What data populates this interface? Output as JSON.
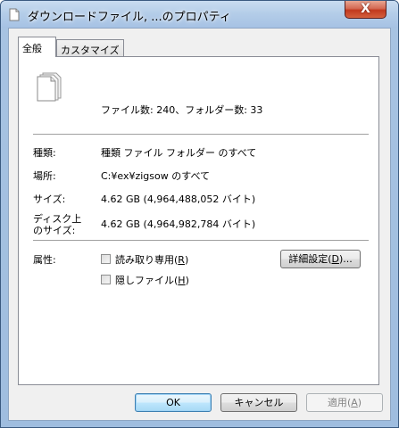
{
  "window": {
    "title": "ダウンロードファイル, ...のプロパティ",
    "close_label": "X"
  },
  "tabs": [
    {
      "label": "全般"
    },
    {
      "label": "カスタマイズ"
    }
  ],
  "general": {
    "file_count_text": "ファイル数: 240、フォルダー数: 33",
    "type_label": "種類:",
    "type_value": "種類 ファイル フォルダー のすべて",
    "location_label": "場所:",
    "location_value": "C:¥ex¥zigsow のすべて",
    "size_label": "サイズ:",
    "size_value": "4.62 GB (4,964,488,052 バイト)",
    "disk_size_label_line1": "ディスク上",
    "disk_size_label_line2": "のサイズ:",
    "disk_size_value": "4.62 GB (4,964,982,784 バイト)",
    "attributes_label": "属性:",
    "readonly_label": "読み取り専用",
    "readonly_key": "R",
    "hidden_label": "隠しファイル",
    "hidden_key": "H",
    "advanced_label": "詳細設定",
    "advanced_key": "D"
  },
  "buttons": {
    "ok": "OK",
    "cancel": "キャンセル",
    "apply": "適用",
    "apply_key": "A"
  }
}
